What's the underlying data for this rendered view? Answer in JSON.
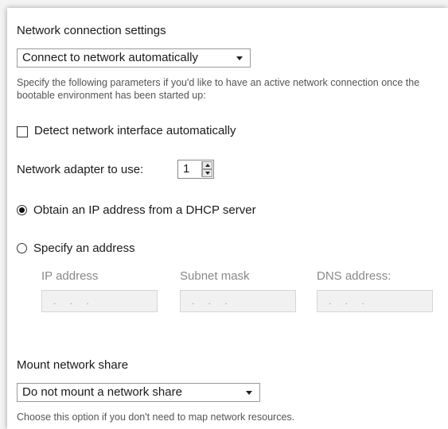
{
  "network": {
    "section_title": "Network connection settings",
    "mode_select": {
      "value": "Connect to network automatically"
    },
    "description": "Specify the following parameters if you'd like to have an active network connection once the bootable environment has been started up:",
    "detect_interface": {
      "label": "Detect network interface automatically",
      "checked": false
    },
    "adapter": {
      "label": "Network adapter to use:",
      "value": "1"
    },
    "dhcp_option": {
      "label": "Obtain an IP address from a DHCP server",
      "selected": true
    },
    "static_option": {
      "label": "Specify an address",
      "selected": false
    },
    "fields": [
      {
        "label": "IP address",
        "value": ". . ."
      },
      {
        "label": "Subnet mask",
        "value": ". . ."
      },
      {
        "label": "DNS address:",
        "value": ". . ."
      }
    ]
  },
  "mount": {
    "section_title": "Mount network share",
    "select": {
      "value": "Do not mount a network share"
    },
    "description": "Choose this option if you don't need to map network resources."
  },
  "icons": [
    "checkbox-icon",
    "radio-icon",
    "dropdown-arrow-icon",
    "spinner-up-icon",
    "spinner-down-icon"
  ]
}
